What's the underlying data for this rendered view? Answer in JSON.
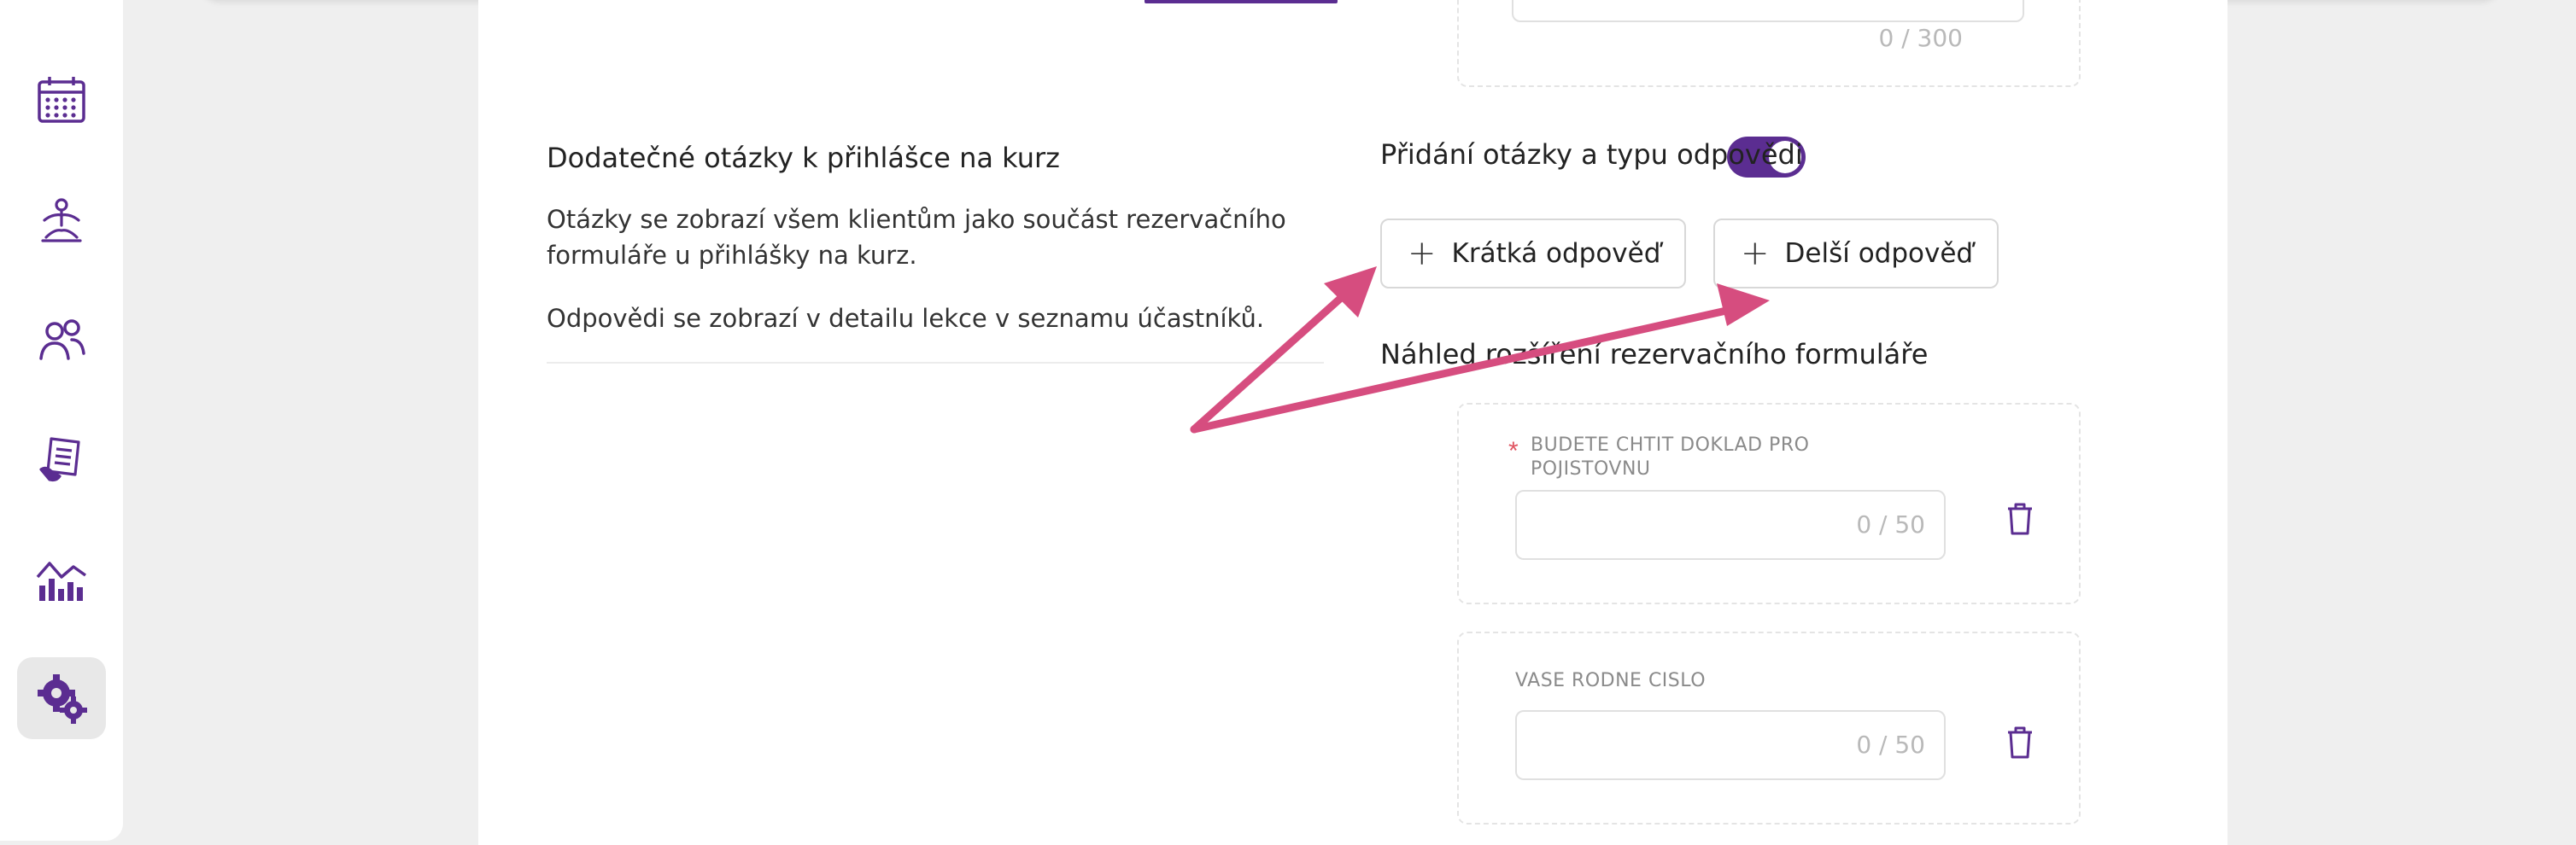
{
  "sidebar": {
    "items": [
      {
        "name": "nav-calendar",
        "icon": "calendar-icon"
      },
      {
        "name": "nav-classes",
        "icon": "yoga-meditation-icon"
      },
      {
        "name": "nav-clients",
        "icon": "users-icon"
      },
      {
        "name": "nav-documents",
        "icon": "document-hand-icon"
      },
      {
        "name": "nav-statistics",
        "icon": "bar-chart-trend-icon"
      },
      {
        "name": "nav-settings",
        "icon": "gears-icon",
        "active": true
      }
    ]
  },
  "top_field": {
    "counter": "0 / 300"
  },
  "questions_section": {
    "title": "Dodatečné otázky k přihlášce na kurz",
    "toggle_on": true,
    "desc1": "Otázky se zobrazí všem klientům jako součást rezervačního formuláře u přihlášky na kurz.",
    "desc2": "Odpovědi se zobrazí v detailu lekce v seznamu účastníků."
  },
  "add_question": {
    "title": "Přidání otázky a typu odpovědi",
    "short_button": "Krátká odpověď",
    "long_button": "Delší odpověď"
  },
  "preview": {
    "title": "Náhled rozšíření rezervačního formuláře",
    "fields": [
      {
        "label": "BUDETE CHTIT DOKLAD PRO POJISTOVNU",
        "required": true,
        "counter": "0 / 50"
      },
      {
        "label": "VASE RODNE CISLO",
        "required": false,
        "counter": "0 / 50"
      }
    ]
  },
  "colors": {
    "accent": "#5b2d91",
    "arrow": "#d64d7f",
    "required": "#e05561"
  }
}
